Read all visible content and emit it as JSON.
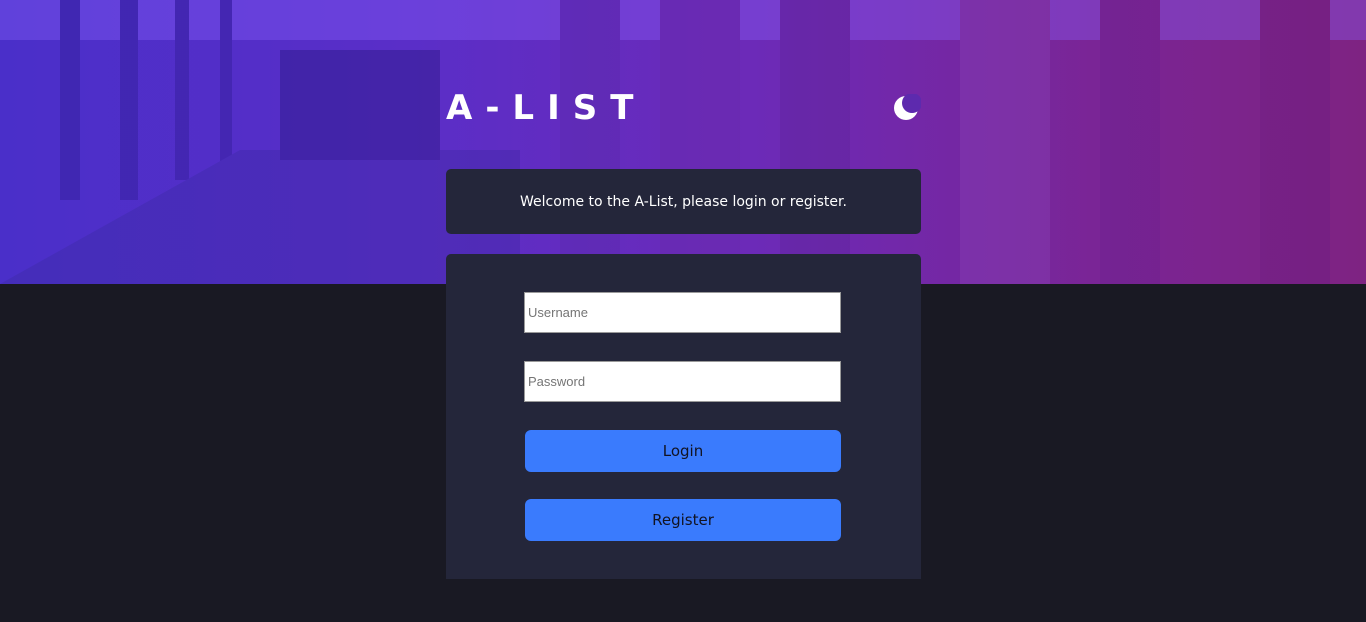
{
  "header": {
    "logo_text": "A-LIST",
    "theme_toggle_icon": "moon-icon"
  },
  "welcome": {
    "message": "Welcome to the A-List, please login or register."
  },
  "form": {
    "username_placeholder": "Username",
    "username_value": "",
    "password_placeholder": "Password",
    "password_value": "",
    "login_label": "Login",
    "register_label": "Register"
  },
  "colors": {
    "page_background": "#191923",
    "card_background": "#24263a",
    "button_color": "#3a7bfd",
    "hero_gradient_start": "#4a2fc9",
    "hero_gradient_end": "#7e2382"
  }
}
